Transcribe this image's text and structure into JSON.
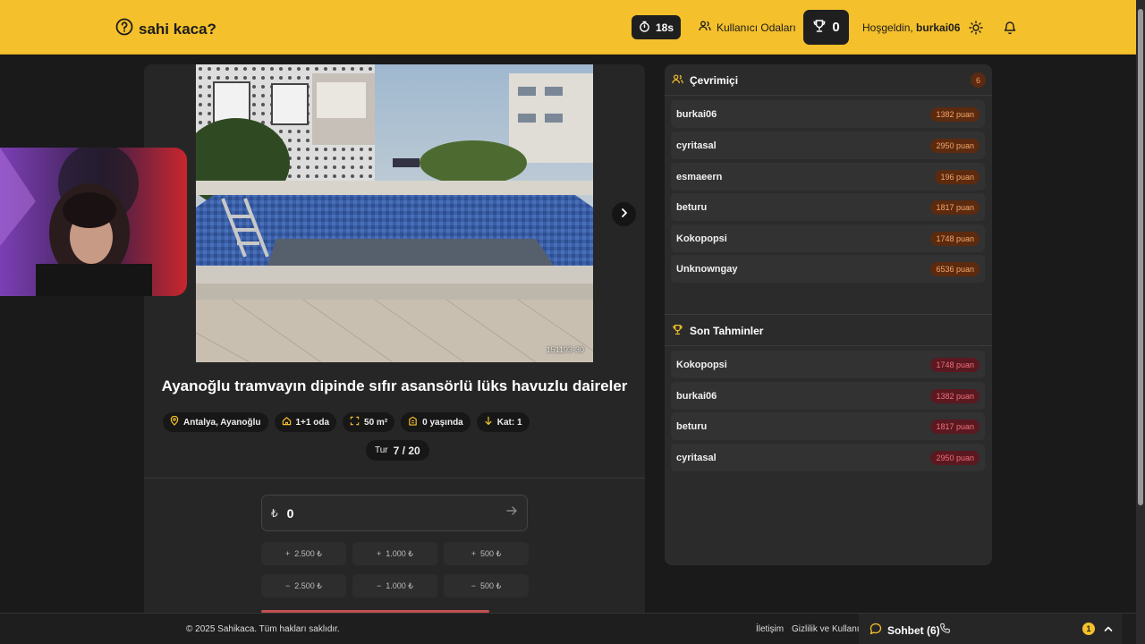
{
  "header": {
    "logo_text": "sahi kaca?",
    "timer": "18s",
    "rooms_label": "Kullanıcı Odaları",
    "score": "0",
    "greeting_prefix": "Hoşgeldin,",
    "username": "burkai06"
  },
  "listing": {
    "image_id": "151193-30",
    "title": "Ayanoğlu tramvayın dipinde sıfır asansörlü lüks havuzlu daireler",
    "chips": [
      {
        "icon": "location-pin-icon",
        "label": "Antalya, Ayanoğlu"
      },
      {
        "icon": "home-icon",
        "label": "1+1 oda"
      },
      {
        "icon": "area-icon",
        "label": "50 m²"
      },
      {
        "icon": "building-icon",
        "label": "0 yaşında"
      },
      {
        "icon": "arrow-down-icon",
        "label": "Kat: 1"
      }
    ],
    "round_label": "Tur",
    "round_value": "7 / 20"
  },
  "guess": {
    "currency": "₺",
    "value": "0",
    "steps": [
      {
        "sign": "+",
        "label": "2.500 ₺"
      },
      {
        "sign": "+",
        "label": "1.000 ₺"
      },
      {
        "sign": "+",
        "label": "500 ₺"
      },
      {
        "sign": "−",
        "label": "2.500 ₺"
      },
      {
        "sign": "−",
        "label": "1.000 ₺"
      },
      {
        "sign": "−",
        "label": "500 ₺"
      }
    ]
  },
  "online": {
    "title": "Çevrimiçi",
    "count": "6",
    "users": [
      {
        "name": "burkai06",
        "points": "1382 puan"
      },
      {
        "name": "cyritasal",
        "points": "2950 puan"
      },
      {
        "name": "esmaeern",
        "points": "196 puan"
      },
      {
        "name": "beturu",
        "points": "1817 puan"
      },
      {
        "name": "Kokopopsi",
        "points": "1748 puan"
      },
      {
        "name": "Unknowngay",
        "points": "6536 puan"
      }
    ]
  },
  "recent": {
    "title": "Son Tahminler",
    "entries": [
      {
        "name": "Kokopopsi",
        "points": "1748 puan"
      },
      {
        "name": "burkai06",
        "points": "1382 puan"
      },
      {
        "name": "beturu",
        "points": "1817 puan"
      },
      {
        "name": "cyritasal",
        "points": "2950 puan"
      }
    ]
  },
  "footer": {
    "copyright": "© 2025 Sahikaca. Tüm hakları saklıdır.",
    "contact": "İletişim",
    "privacy": "Gizlilik ve Kullanım",
    "chat_label": "Sohbet (6)",
    "unread": "1"
  },
  "colors": {
    "brand": "#f4c02b",
    "online_points": "#f3a668",
    "recent_points": "#f0707a"
  }
}
